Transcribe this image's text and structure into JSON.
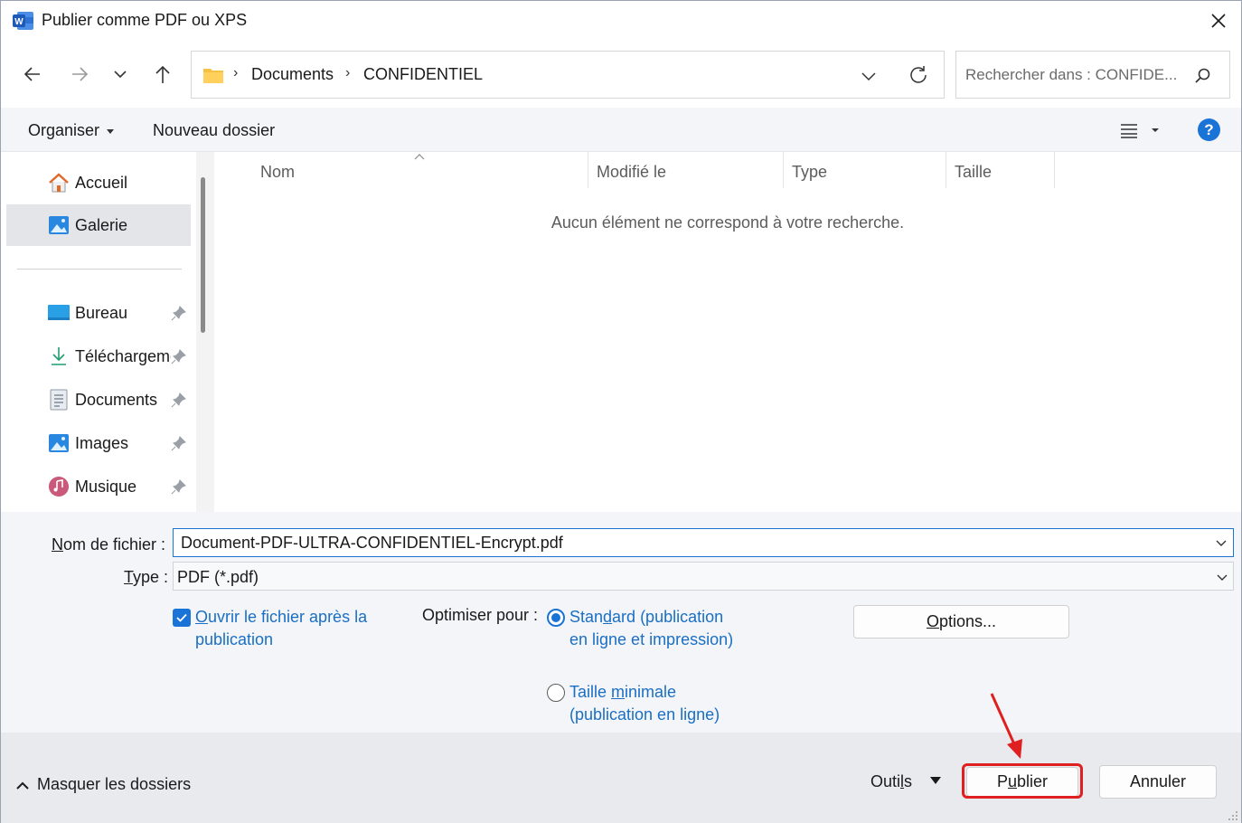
{
  "window": {
    "title": "Publier comme PDF ou XPS",
    "app_icon_letter": "W",
    "app_icon_color": "#1e5bb8"
  },
  "address_bar": {
    "crumbs": [
      "Documents",
      "CONFIDENTIEL"
    ],
    "separator": "›"
  },
  "search": {
    "placeholder": "Rechercher dans : CONFIDE..."
  },
  "command_bar": {
    "organize_label": "Organiser",
    "new_folder_label": "Nouveau dossier",
    "help_label": "?"
  },
  "sidebar": {
    "items": [
      {
        "label": "Accueil",
        "icon": "home-icon",
        "selected": false,
        "pinned": false
      },
      {
        "label": "Galerie",
        "icon": "gallery-icon",
        "selected": true,
        "pinned": false
      },
      {
        "label": "Bureau",
        "icon": "desktop-icon",
        "selected": false,
        "pinned": true
      },
      {
        "label": "Téléchargements",
        "icon": "download-icon",
        "selected": false,
        "pinned": true
      },
      {
        "label": "Documents",
        "icon": "documents-icon",
        "selected": false,
        "pinned": true
      },
      {
        "label": "Images",
        "icon": "pictures-icon",
        "selected": false,
        "pinned": true
      },
      {
        "label": "Musique",
        "icon": "music-icon",
        "selected": false,
        "pinned": true
      }
    ]
  },
  "file_list": {
    "columns": [
      "Nom",
      "Modifié le",
      "Type",
      "Taille"
    ],
    "empty_message": "Aucun élément ne correspond à votre recherche."
  },
  "form": {
    "filename_label_prefix": "N",
    "filename_label_rest": "om de fichier :",
    "filename_value": "Document-PDF-ULTRA-CONFIDENTIEL-Encrypt.pdf",
    "type_label_prefix": "T",
    "type_label_rest": "ype :",
    "type_value": "PDF (*.pdf)",
    "open_after_checked": true,
    "open_after_prefix": "O",
    "open_after_rest": "uvrir le fichier après la publication",
    "optimize_label": "Optimiser pour :",
    "radio_standard_part1": "Stan",
    "radio_standard_u": "d",
    "radio_standard_part2": "ard (publication en ligne et impression)",
    "radio_standard_checked": true,
    "radio_min_part1": "Taille ",
    "radio_min_u": "m",
    "radio_min_part2": "inimale (publication en ligne)",
    "radio_min_checked": false,
    "options_prefix": "O",
    "options_rest": "ptions..."
  },
  "bottom": {
    "hide_folders_label": "Masquer les dossiers",
    "tools_prefix": "Outi",
    "tools_u": "l",
    "tools_rest": "s",
    "publish_prefix": "P",
    "publish_u": "u",
    "publish_rest": "blier",
    "cancel_label": "Annuler"
  },
  "colors": {
    "accent": "#1a73d6",
    "link": "#1a6fc4",
    "annotation": "#e02020"
  }
}
